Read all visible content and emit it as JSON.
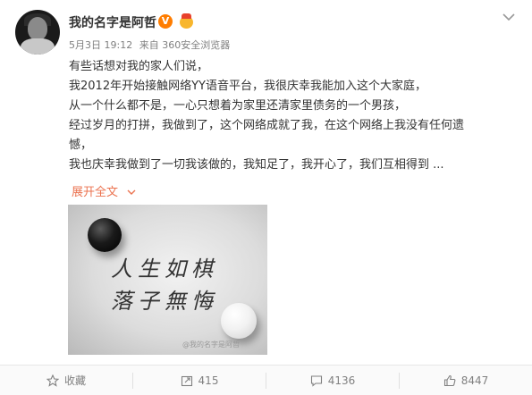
{
  "post": {
    "username": "我的名字是阿哲",
    "verified_badge": "V",
    "date": "5月3日 19:12",
    "source": "来自 360安全浏览器",
    "lines": [
      "有些话想对我的家人们说，",
      "我2012年开始接触网络YY语音平台，我很庆幸我能加入这个大家庭，",
      "从一个什么都不是，一心只想着为家里还清家里债务的一个男孩，",
      "经过岁月的打拼，我做到了，这个网络成就了我，在这个网络上我没有任何遗",
      "憾，",
      "我也庆幸我做到了一切我该做的，我知足了，我开心了，我们互相得到 ..."
    ],
    "expand_label": "展开全文",
    "image": {
      "calligraphy_line1": "人生如棋",
      "calligraphy_line2": "落子無悔",
      "watermark": "@我的名字是阿哲"
    }
  },
  "actions": {
    "favorite": "收藏",
    "repost": "415",
    "comment": "4136",
    "like": "8447"
  },
  "colors": {
    "accent": "#eb7350",
    "verified": "#ff7d00"
  },
  "icons": [
    "star-icon",
    "share-icon",
    "comment-icon",
    "thumbs-up-icon",
    "chevron-down-icon"
  ]
}
